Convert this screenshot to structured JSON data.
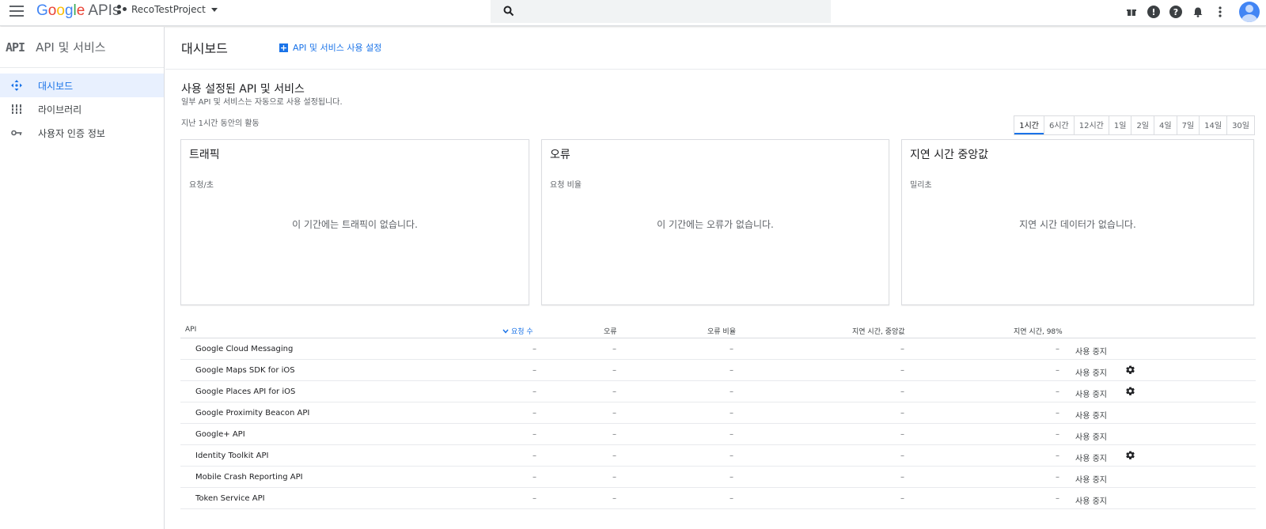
{
  "topbar": {
    "logo_google": "Google",
    "logo_apis": "APIs",
    "project_name": "RecoTestProject",
    "search_placeholder": ""
  },
  "icons": {
    "menu": "menu-icon",
    "project": "project-dots-icon",
    "search": "search-icon",
    "gift": "gift-icon",
    "feedback": "feedback-icon",
    "help": "help-icon",
    "notifications": "bell-icon",
    "more": "more-vert-icon",
    "avatar": "account-icon"
  },
  "sidebar": {
    "badge": "API",
    "title": "API 및 서비스",
    "items": [
      {
        "label": "대시보드",
        "icon": "dashboard-icon",
        "active": true
      },
      {
        "label": "라이브러리",
        "icon": "library-icon",
        "active": false
      },
      {
        "label": "사용자 인증 정보",
        "icon": "key-icon",
        "active": false
      }
    ]
  },
  "main": {
    "page_title": "대시보드",
    "enable_button": "API 및 서비스 사용 설정",
    "section_title": "사용 설정된 API 및 서비스",
    "section_subtitle": "일부 API 및 서비스는 자동으로 사용 설정됩니다.",
    "activity_label": "지난 1시간 동안의 활동",
    "time_ranges": [
      "1시간",
      "6시간",
      "12시간",
      "1일",
      "2일",
      "4일",
      "7일",
      "14일",
      "30일"
    ],
    "selected_range": "1시간",
    "cards": [
      {
        "title": "트래픽",
        "unit": "요청/초",
        "empty": "이 기간에는 트래픽이 없습니다."
      },
      {
        "title": "오류",
        "unit": "요청 비율",
        "empty": "이 기간에는 오류가 없습니다."
      },
      {
        "title": "지연 시간 중앙값",
        "unit": "밀리초",
        "empty": "지연 시간 데이터가 없습니다."
      }
    ]
  },
  "table": {
    "headers": {
      "api": "API",
      "requests": "요청 수",
      "errors": "오류",
      "error_rate": "오류 비율",
      "latency_median": "지연 시간, 중앙값",
      "latency_98": "지연 시간, 98%"
    },
    "disable_label": "사용 중지",
    "rows": [
      {
        "name": "Google Cloud Messaging",
        "requests": "–",
        "errors": "–",
        "error_rate": "–",
        "latency_median": "–",
        "latency_98": "–",
        "gear": false
      },
      {
        "name": "Google Maps SDK for iOS",
        "requests": "–",
        "errors": "–",
        "error_rate": "–",
        "latency_median": "–",
        "latency_98": "–",
        "gear": true
      },
      {
        "name": "Google Places API for iOS",
        "requests": "–",
        "errors": "–",
        "error_rate": "–",
        "latency_median": "–",
        "latency_98": "–",
        "gear": true
      },
      {
        "name": "Google Proximity Beacon API",
        "requests": "–",
        "errors": "–",
        "error_rate": "–",
        "latency_median": "–",
        "latency_98": "–",
        "gear": false
      },
      {
        "name": "Google+ API",
        "requests": "–",
        "errors": "–",
        "error_rate": "–",
        "latency_median": "–",
        "latency_98": "–",
        "gear": false
      },
      {
        "name": "Identity Toolkit API",
        "requests": "–",
        "errors": "–",
        "error_rate": "–",
        "latency_median": "–",
        "latency_98": "–",
        "gear": true
      },
      {
        "name": "Mobile Crash Reporting API",
        "requests": "–",
        "errors": "–",
        "error_rate": "–",
        "latency_median": "–",
        "latency_98": "–",
        "gear": false
      },
      {
        "name": "Token Service API",
        "requests": "–",
        "errors": "–",
        "error_rate": "–",
        "latency_median": "–",
        "latency_98": "–",
        "gear": false
      }
    ]
  },
  "colors": {
    "accent": "#1a73e8",
    "active_bg": "#e8f0fe",
    "border": "#dadce0"
  }
}
